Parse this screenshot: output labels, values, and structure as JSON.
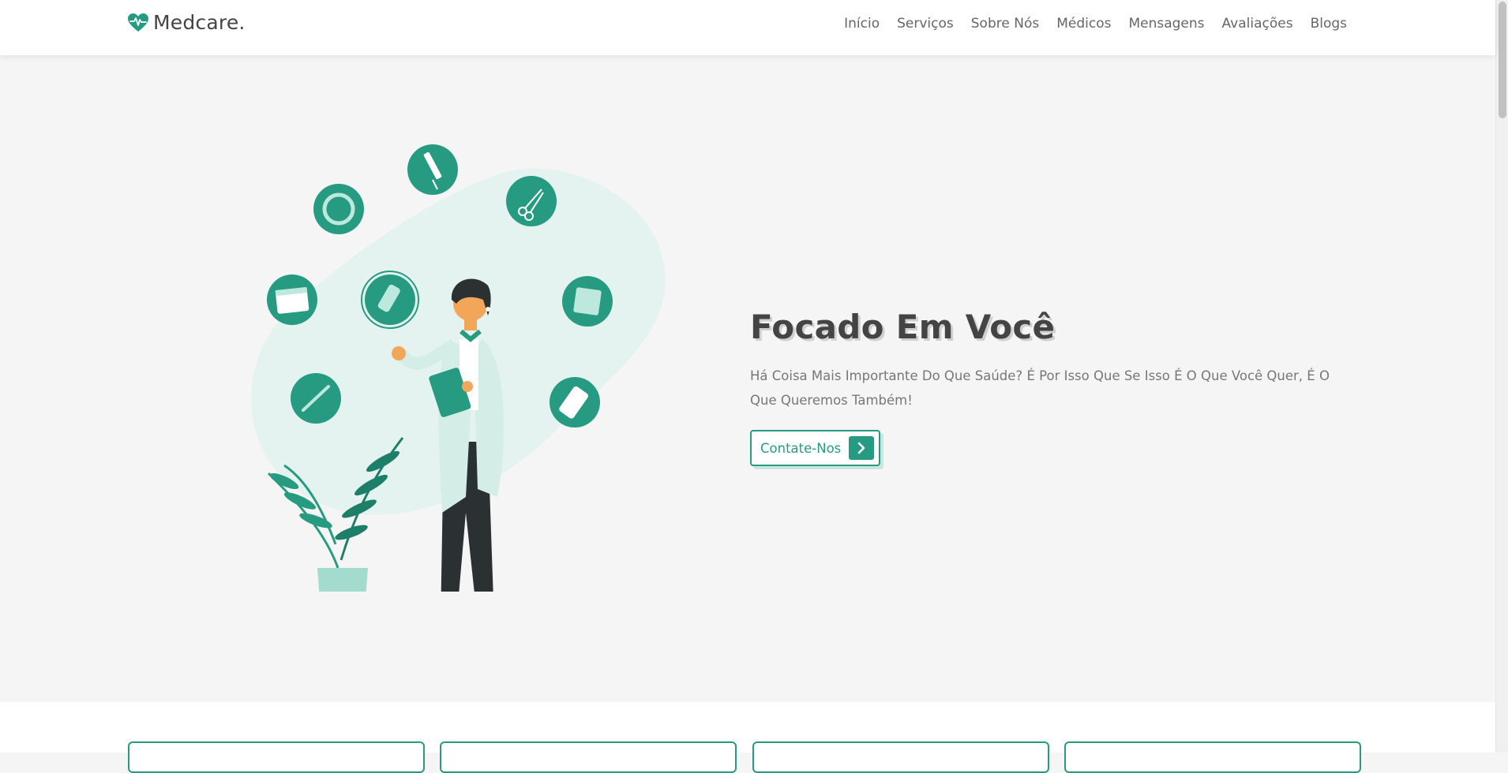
{
  "brand": {
    "name": "Medcare.",
    "accent_color": "#279b82",
    "logo_icon": "heart-pulse-icon"
  },
  "nav": {
    "items": [
      "Início",
      "Serviços",
      "Sobre Nós",
      "Médicos",
      "Mensagens",
      "Avaliações",
      "Blogs"
    ]
  },
  "hero": {
    "title": "Focado Em Você",
    "text": "Há Coisa Mais Importante Do Que Saúde? É Por Isso Que Se Isso É O Que Você Quer, É O Que Queremos Também!",
    "cta_label": "Contate-Nos",
    "cta_icon": "chevron-right-icon",
    "illustration": "doctor-with-medical-icons-illustration"
  },
  "icons": {
    "medical": [
      "syringe-icon",
      "scissors-icon",
      "ring-icon",
      "calendar-icon",
      "bandage-icon",
      "gauze-icon",
      "pill-pack-icon",
      "thermometer-icon"
    ]
  }
}
